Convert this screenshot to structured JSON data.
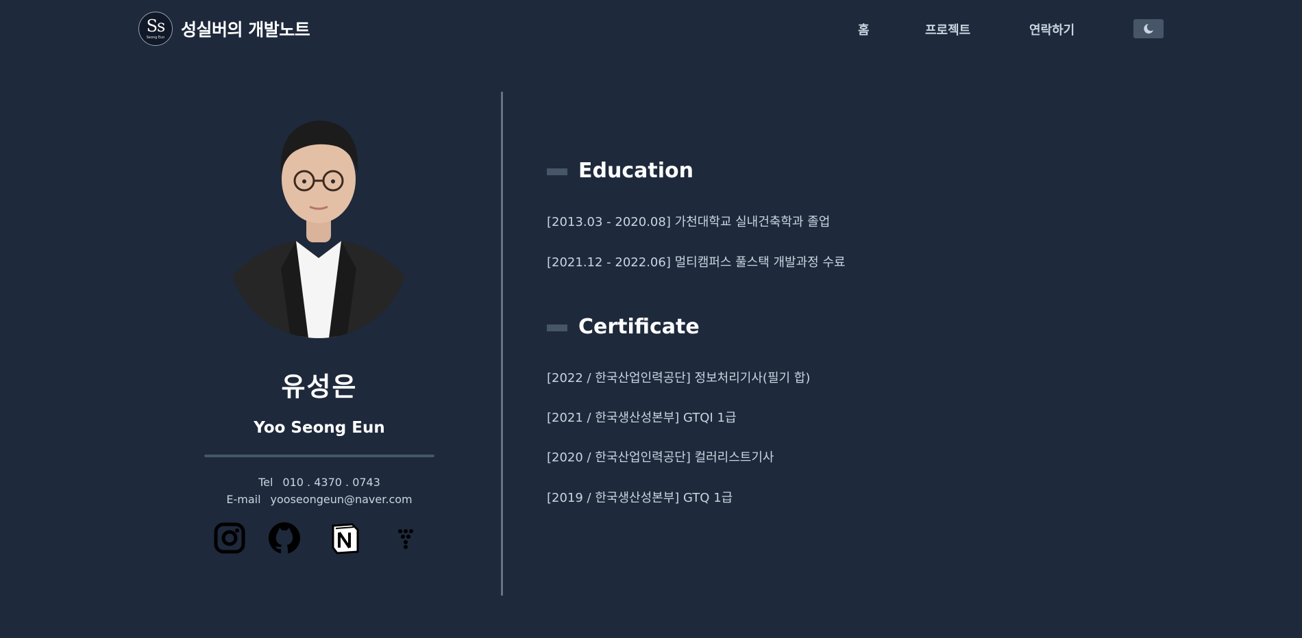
{
  "header": {
    "logo_text": "Ss",
    "logo_subtext": "Seong Eun",
    "site_title": "성실버의 개발노트",
    "nav": [
      {
        "label": "홈"
      },
      {
        "label": "프로젝트"
      },
      {
        "label": "연락하기"
      }
    ],
    "theme_icon": "moon-icon"
  },
  "profile": {
    "name_ko": "유성은",
    "name_en": "Yoo Seong Eun",
    "tel_label": "Tel",
    "tel": "010 . 4370 . 0743",
    "email_label": "E-mail",
    "email": "yooseongeun@naver.com",
    "social_icons": [
      "instagram-icon",
      "github-icon",
      "notion-icon",
      "velog-icon"
    ]
  },
  "education": {
    "title": "Education",
    "items": [
      "[2013.03  -  2020.08]  가천대학교 실내건축학과 졸업",
      "[2021.12  -  2022.06]  멀티캠퍼스 풀스택 개발과정 수료"
    ]
  },
  "certificate": {
    "title": "Certificate",
    "items": [
      "[2022 / 한국산업인력공단]  정보처리기사(필기 합)",
      "[2021 / 한국생산성본부]  GTQI 1급",
      "[2020 / 한국산업인력공단]  컬러리스트기사",
      "[2019 / 한국생산성본부]  GTQ 1급"
    ]
  },
  "colors": {
    "background": "#1e293b",
    "divider": "#64748b",
    "accent_bar": "#475569",
    "text": "#cbd5e1",
    "heading": "#ffffff"
  }
}
